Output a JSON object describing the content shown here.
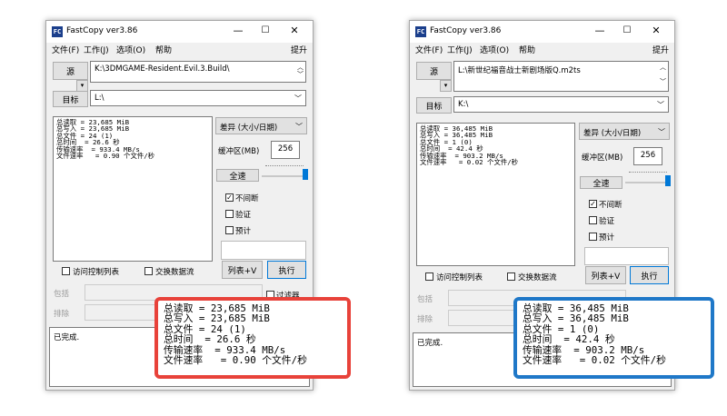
{
  "windows": [
    {
      "title": "FastCopy ver3.86",
      "menu": [
        "文件(F)",
        "工作(J)",
        "选项(O)",
        "帮助"
      ],
      "menu_right": "提升",
      "source_label": "源",
      "source_path": "K:\\3DMGAME-Resident.Evil.3.Build\\",
      "dest_label": "目标",
      "dest_path": "L:\\",
      "stats_lines": [
        "总读取 = 23,685 MiB",
        "总写入 = 23,685 MiB",
        "总文件 = 24 (1)",
        "总时间  = 26.6 秒",
        "传输速率  = 933.4 MB/s",
        "文件速率   = 0.90 个文件/秒"
      ],
      "mode": "差异 (大小/日期)",
      "buffer_label": "缓冲区(MB)",
      "buffer_value": "256",
      "full_speed": "全速",
      "opt_nonstop": "不间断",
      "opt_verify": "验证",
      "opt_estimate": "预计",
      "acl": "访问控制列表",
      "ads": "交换数据流",
      "listv_button": "列表+V",
      "exec_button": "执行",
      "include_label": "包括",
      "exclude_label": "排除",
      "filter_label": "过滤器",
      "status": "已完成.",
      "zoom_lines": [
        "总读取 = 23,685 MiB",
        "总写入 = 23,685 MiB",
        "总文件 = 24 (1)",
        "总时间  = 26.6 秒",
        "传输速率  = 933.4 MB/s",
        "文件速率   = 0.90 个文件/秒"
      ]
    },
    {
      "title": "FastCopy ver3.86",
      "menu": [
        "文件(F)",
        "工作(J)",
        "选项(O)",
        "帮助"
      ],
      "menu_right": "提升",
      "source_label": "源",
      "source_path": "L:\\新世纪福音战士新剧场版Q.m2ts",
      "dest_label": "目标",
      "dest_path": "K:\\",
      "stats_lines": [
        "总读取 = 36,485 MiB",
        "总写入 = 36,485 MiB",
        "总文件 = 1 (0)",
        "总时间  = 42.4 秒",
        "传输速率  = 903.2 MB/s",
        "文件速率   = 0.02 个文件/秒"
      ],
      "mode": "差异 (大小/日期)",
      "buffer_label": "缓冲区(MB)",
      "buffer_value": "256",
      "full_speed": "全速",
      "opt_nonstop": "不间断",
      "opt_verify": "验证",
      "opt_estimate": "预计",
      "acl": "访问控制列表",
      "ads": "交换数据流",
      "listv_button": "列表+V",
      "exec_button": "执行",
      "include_label": "包括",
      "exclude_label": "排除",
      "status": "已完成.",
      "zoom_lines": [
        "总读取 = 36,485 MiB",
        "总写入 = 36,485 MiB",
        "总文件 = 1 (0)",
        "总时间  = 42.4 秒",
        "传输速率  = 903.2 MB/s",
        "文件速率   = 0.02 个文件/秒"
      ]
    }
  ],
  "colors": {
    "highlight_left": "#e8423a",
    "highlight_right": "#1f78c8",
    "accent": "#0078d7"
  }
}
